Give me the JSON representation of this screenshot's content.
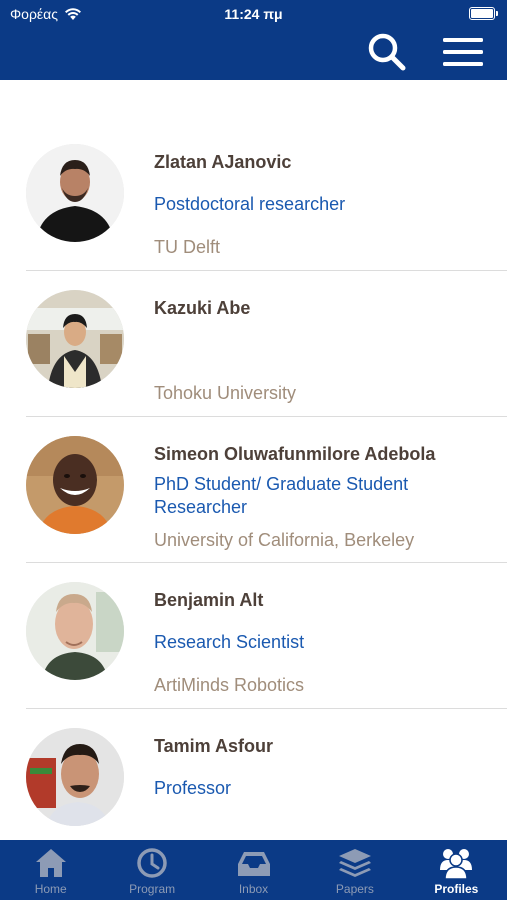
{
  "status": {
    "carrier": "Φορέας",
    "time": "11:24 πμ"
  },
  "header": {
    "search_icon": "search-icon",
    "menu_icon": "hamburger-menu-icon",
    "background": "#0b3a86"
  },
  "profiles": [
    {
      "name": "Zlatan AJanovic",
      "role": "Postdoctoral researcher",
      "organization": "TU Delft"
    },
    {
      "name": "Kazuki Abe",
      "role": "",
      "organization": "Tohoku University"
    },
    {
      "name": "Simeon Oluwafunmilore Adebola",
      "role": "PhD Student/ Graduate Student Researcher",
      "organization": "University of California, Berkeley"
    },
    {
      "name": "Benjamin Alt",
      "role": "Research Scientist",
      "organization": "ArtiMinds Robotics"
    },
    {
      "name": "Tamim Asfour",
      "role": "Professor",
      "organization": ""
    }
  ],
  "tabs": [
    {
      "label": "Home",
      "icon": "home-icon"
    },
    {
      "label": "Program",
      "icon": "clock-icon"
    },
    {
      "label": "Inbox",
      "icon": "inbox-icon"
    },
    {
      "label": "Papers",
      "icon": "layers-icon"
    },
    {
      "label": "Profiles",
      "icon": "people-icon",
      "active": true
    }
  ],
  "colors": {
    "brand": "#0b3a86",
    "name": "#4d4039",
    "role": "#1a59b0",
    "organization": "#a08d7b"
  }
}
